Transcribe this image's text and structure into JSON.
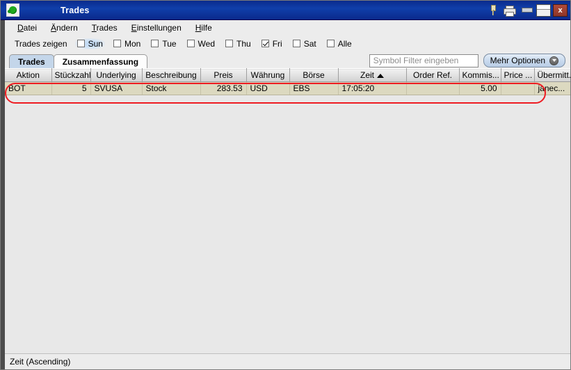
{
  "window": {
    "title": "Trades",
    "app_icon": "green-blob-icon",
    "tools": [
      {
        "name": "pin-icon",
        "label": ""
      },
      {
        "name": "printer-icon",
        "label": ""
      }
    ],
    "controls": {
      "minimize": "",
      "maximize": "",
      "close": "x"
    }
  },
  "menubar": {
    "items": [
      {
        "mnemonic": "D",
        "rest": "atei"
      },
      {
        "mnemonic": "Ä",
        "rest": "ndern"
      },
      {
        "mnemonic": "T",
        "rest": "rades"
      },
      {
        "mnemonic": "E",
        "rest": "instellungen"
      },
      {
        "mnemonic": "H",
        "rest": "ilfe"
      }
    ]
  },
  "day_filter": {
    "label": "Trades zeigen",
    "checkboxes": [
      {
        "label": "Sun",
        "checked": false,
        "focused": true
      },
      {
        "label": "Mon",
        "checked": false,
        "focused": false
      },
      {
        "label": "Tue",
        "checked": false,
        "focused": false
      },
      {
        "label": "Wed",
        "checked": false,
        "focused": false
      },
      {
        "label": "Thu",
        "checked": false,
        "focused": false
      },
      {
        "label": "Fri",
        "checked": true,
        "focused": false
      },
      {
        "label": "Sat",
        "checked": false,
        "focused": false
      },
      {
        "label": "Alle",
        "checked": false,
        "focused": false
      }
    ]
  },
  "tabs": [
    {
      "label": "Trades",
      "active": true
    },
    {
      "label": "Zusammenfassung",
      "active": false
    }
  ],
  "toolbar": {
    "filter_placeholder": "Symbol Filter eingeben",
    "filter_value": "",
    "more_options_label": "Mehr Optionen",
    "more_options_icon": "chevron-down-icon"
  },
  "table": {
    "columns": [
      {
        "label": "Aktion",
        "width": 67,
        "align": "left",
        "sorted": false
      },
      {
        "label": "Stückzahl",
        "width": 56,
        "align": "right",
        "sorted": false
      },
      {
        "label": "Underlying",
        "width": 74,
        "align": "left",
        "sorted": false
      },
      {
        "label": "Beschreibung",
        "width": 84,
        "align": "left",
        "sorted": false
      },
      {
        "label": "Preis",
        "width": 66,
        "align": "right",
        "sorted": false
      },
      {
        "label": "Währung",
        "width": 62,
        "align": "left",
        "sorted": false
      },
      {
        "label": "Börse",
        "width": 70,
        "align": "left",
        "sorted": false
      },
      {
        "label": "Zeit",
        "width": 98,
        "align": "left",
        "sorted": true,
        "sort_dir": "asc"
      },
      {
        "label": "Order Ref.",
        "width": 76,
        "align": "right",
        "sorted": false
      },
      {
        "label": "Kommis...",
        "width": 60,
        "align": "right",
        "sorted": false
      },
      {
        "label": "Price ...",
        "width": 48,
        "align": "right",
        "sorted": false
      },
      {
        "label": "Übermitt...",
        "width": 60,
        "align": "left",
        "sorted": false
      }
    ],
    "rows": [
      {
        "cells": [
          "BOT",
          "5",
          "SVUSA",
          "Stock",
          "283.53",
          "USD",
          "EBS",
          "17:05:20",
          "",
          "5.00",
          "",
          "janec..."
        ]
      }
    ]
  },
  "annotation": {
    "shape": "ellipse",
    "color": "#ee1c22",
    "target": "first-trade-row"
  },
  "statusbar": {
    "text": "Zeit (Ascending)"
  }
}
